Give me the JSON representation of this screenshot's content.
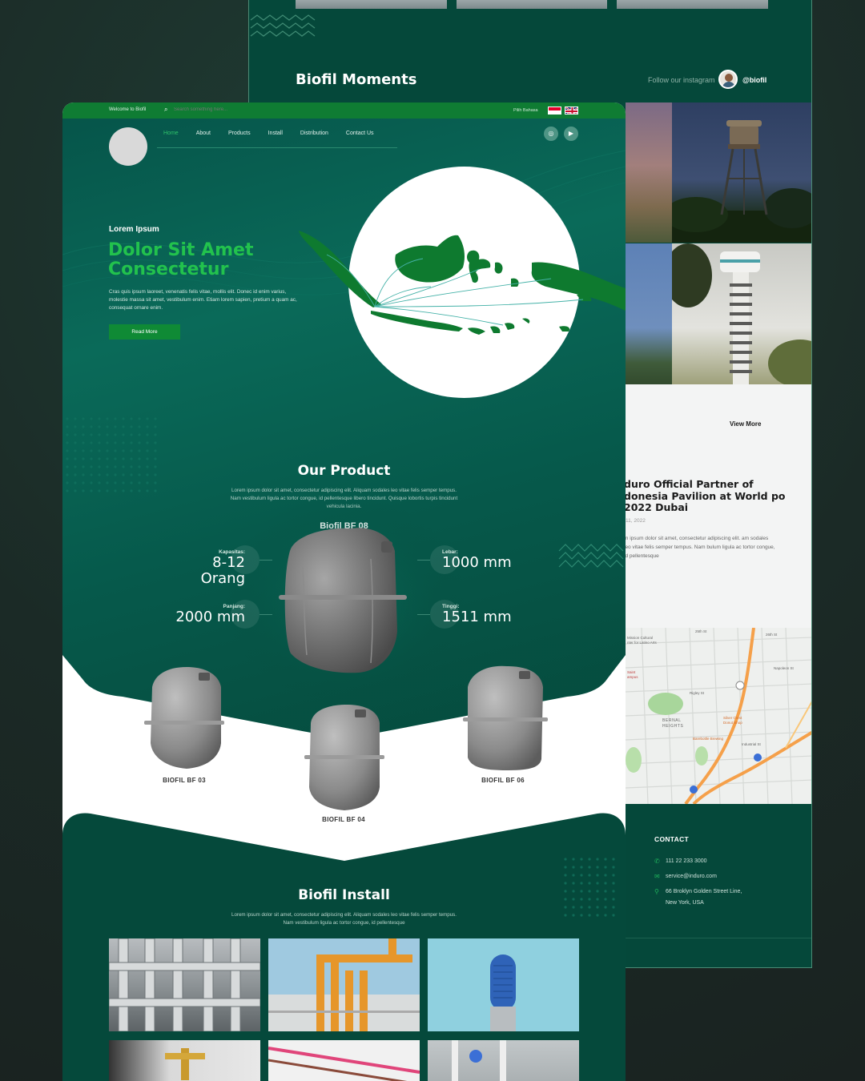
{
  "back_page": {
    "moments_title": "Biofil Moments",
    "follow_text": "Follow our instagram",
    "instagram_handle": "@biofil",
    "view_more": "View More",
    "news": {
      "title": "duro Official Partner of donesia Pavilion at World po 2022 Dubai",
      "date": "11, 2022",
      "body": "m ipsum dolor sit amet, consectetur adipiscing elit. am sodales leo vitae felis semper tempus. Nam bulum ligula ac tortor congue, id pellentesque"
    },
    "map_labels": {
      "l1": "Mission Cultural",
      "l2": "nter for Latino Arts",
      "l3": "Saint",
      "l4": "ampus",
      "l5": "BERNAL",
      "l6": "HEIGHTS",
      "l7": "Silver Crest",
      "l8": "Donut Shop",
      "l9": "Barebottle Brewing",
      "l10": "Industrial St",
      "l11": "Rigley St",
      "l12": "Napoleon St",
      "l13": "26th St",
      "l14": "25th St"
    },
    "contact": {
      "heading": "CONTACT",
      "phone": "111 22 233 3000",
      "email": "service@induro.com",
      "address_line1": "66 Broklyn Golden Street Line,",
      "address_line2": "New York, USA"
    }
  },
  "front_page": {
    "topbar": {
      "welcome": "Welcome to Biofil",
      "search_placeholder": "Search something here...",
      "language_label": "Pilih Bahasa"
    },
    "nav": {
      "items": [
        "Home",
        "About",
        "Products",
        "Install",
        "Distribution",
        "Contact Us"
      ],
      "active": "Home"
    },
    "hero": {
      "eyebrow": "Lorem Ipsum",
      "title": "Dolor Sit Amet Consectetur",
      "body": "Cras quis ipsum laoreet, venenatis felis vitae, mollis elit. Donec id enim varius, molestie massa sit amet, vestibulum enim. Etiam lorem sapien, pretium a quam ac, consequat ornare enim.",
      "cta": "Read More"
    },
    "product": {
      "section_title": "Our Product",
      "description": "Lorem ipsum dolor sit amet, consectetur adipiscing elit. Aliquam sodales leo vitae felis semper tempus. Nam vestibulum ligula ac tortor congue, id pellentesque libero tincidunt. Quisque lobortis turpis tincidunt vehicula lacinia.",
      "featured_name": "Biofil BF 08",
      "specs": {
        "kapasitas_label": "Kapasitas:",
        "kapasitas_value": "8-12 Orang",
        "panjang_label": "Panjang:",
        "panjang_value": "2000 mm",
        "lebar_label": "Lebar:",
        "lebar_value": "1000 mm",
        "tinggi_label": "Tinggi:",
        "tinggi_value": "1511 mm"
      },
      "variants": [
        "BIOFIL BF 03",
        "BIOFIL BF 04",
        "BIOFIL BF 06"
      ]
    },
    "install": {
      "section_title": "Biofil Install",
      "description": "Lorem ipsum dolor sit amet, consectetur adipiscing elit. Aliquam sodales leo vitae felis semper tempus. Nam vestibulum ligula ac tortor congue, id pellentesque"
    }
  },
  "colors": {
    "brand_green": "#22c24d",
    "topbar_green": "#0f7c33",
    "dark_teal": "#05493b"
  }
}
